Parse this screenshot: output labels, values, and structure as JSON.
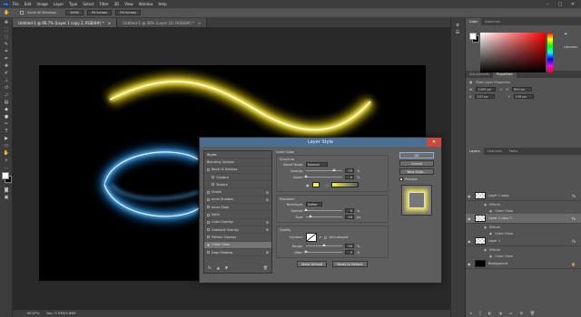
{
  "menubar": {
    "logo": "Ps",
    "items": [
      "File",
      "Edit",
      "Image",
      "Layer",
      "Type",
      "Select",
      "Filter",
      "3D",
      "View",
      "Window",
      "Help"
    ]
  },
  "options": {
    "scroll_all": "Scroll All Windows",
    "zoom_100": "100%",
    "fit_screen": "Fit Screen",
    "fill_screen": "Fill Screen"
  },
  "tabs": [
    {
      "label": "Untitled-1 @ 66.7% (Layer 1 copy 2, RGB/8#) *",
      "active": true
    },
    {
      "label": "Untitled-1 @ 36% (Layer 10, RGB/8#) *",
      "active": false
    }
  ],
  "status": {
    "zoom": "66.67%",
    "doc": "Doc: 5.93M/5.69M"
  },
  "panels": {
    "color_tabs": [
      "Color",
      "Swatches"
    ],
    "libraries": "Libraries",
    "adj_tabs": [
      "Adjustments",
      "Properties"
    ],
    "props_title": "Pixel Layer Properties",
    "w": "1200 px",
    "h": "800 px",
    "x": "237 px",
    "y": "159 px",
    "w_label": "W",
    "h_label": "H",
    "x_label": "X",
    "y_label": "Y",
    "layer_tabs": [
      "Layers",
      "Channels",
      "Paths"
    ],
    "layers": [
      {
        "name": "Layer 1 copy",
        "fx": "fx",
        "selected": false,
        "effects": "Effects",
        "sub": "Outer Glow"
      },
      {
        "name": "Layer 1 copy 2",
        "fx": "fx",
        "selected": true,
        "effects": "Effects",
        "sub": "Outer Glow"
      },
      {
        "name": "Layer 1",
        "fx": "fx",
        "selected": false,
        "effects": "Effects",
        "sub": "Outer Glow"
      },
      {
        "name": "Background",
        "fx": "",
        "selected": false,
        "effects": "",
        "sub": ""
      }
    ]
  },
  "dialog": {
    "title": "Layer Style",
    "styles_header": "Styles",
    "styles": [
      {
        "label": "Blending Options",
        "cb": false,
        "plus": false,
        "active": false,
        "nocb": true
      },
      {
        "label": "Bevel & Emboss",
        "cb": true,
        "plus": false,
        "active": false
      },
      {
        "label": "Contour",
        "cb": true,
        "plus": false,
        "active": false
      },
      {
        "label": "Texture",
        "cb": true,
        "plus": false,
        "active": false
      },
      {
        "label": "Stroke",
        "cb": true,
        "plus": true,
        "active": false
      },
      {
        "label": "Inner Shadow",
        "cb": true,
        "plus": true,
        "active": false
      },
      {
        "label": "Inner Glow",
        "cb": true,
        "plus": false,
        "active": false
      },
      {
        "label": "Satin",
        "cb": true,
        "plus": false,
        "active": false
      },
      {
        "label": "Color Overlay",
        "cb": true,
        "plus": true,
        "active": false
      },
      {
        "label": "Gradient Overlay",
        "cb": true,
        "plus": true,
        "active": false
      },
      {
        "label": "Pattern Overlay",
        "cb": true,
        "plus": false,
        "active": false
      },
      {
        "label": "Outer Glow",
        "cb": true,
        "plus": false,
        "active": true,
        "checked": true
      },
      {
        "label": "Drop Shadow",
        "cb": true,
        "plus": true,
        "active": false
      }
    ],
    "fx_label": "fx",
    "section_title": "Outer Glow",
    "structure": "Structure",
    "blend_mode_label": "Blend Mode:",
    "blend_mode": "Normal",
    "opacity_label": "Opacity:",
    "opacity": "75",
    "noise_label": "Noise:",
    "noise": "0",
    "elements": "Elements",
    "technique_label": "Technique:",
    "technique": "Softer",
    "spread_label": "Spread:",
    "spread": "0",
    "size_label": "Size:",
    "size": "18",
    "quality": "Quality",
    "contour_label": "Contour:",
    "anti_aliased": "Anti-aliased",
    "range_label": "Range:",
    "range": "50",
    "jitter_label": "Jitter:",
    "jitter": "0",
    "pct": "%",
    "px": "px",
    "make_default": "Make Default",
    "reset_default": "Reset to Default",
    "ok": "OK",
    "cancel": "Cancel",
    "new_style": "New Style...",
    "preview": "Preview",
    "glow_color": "#f5ee43"
  }
}
